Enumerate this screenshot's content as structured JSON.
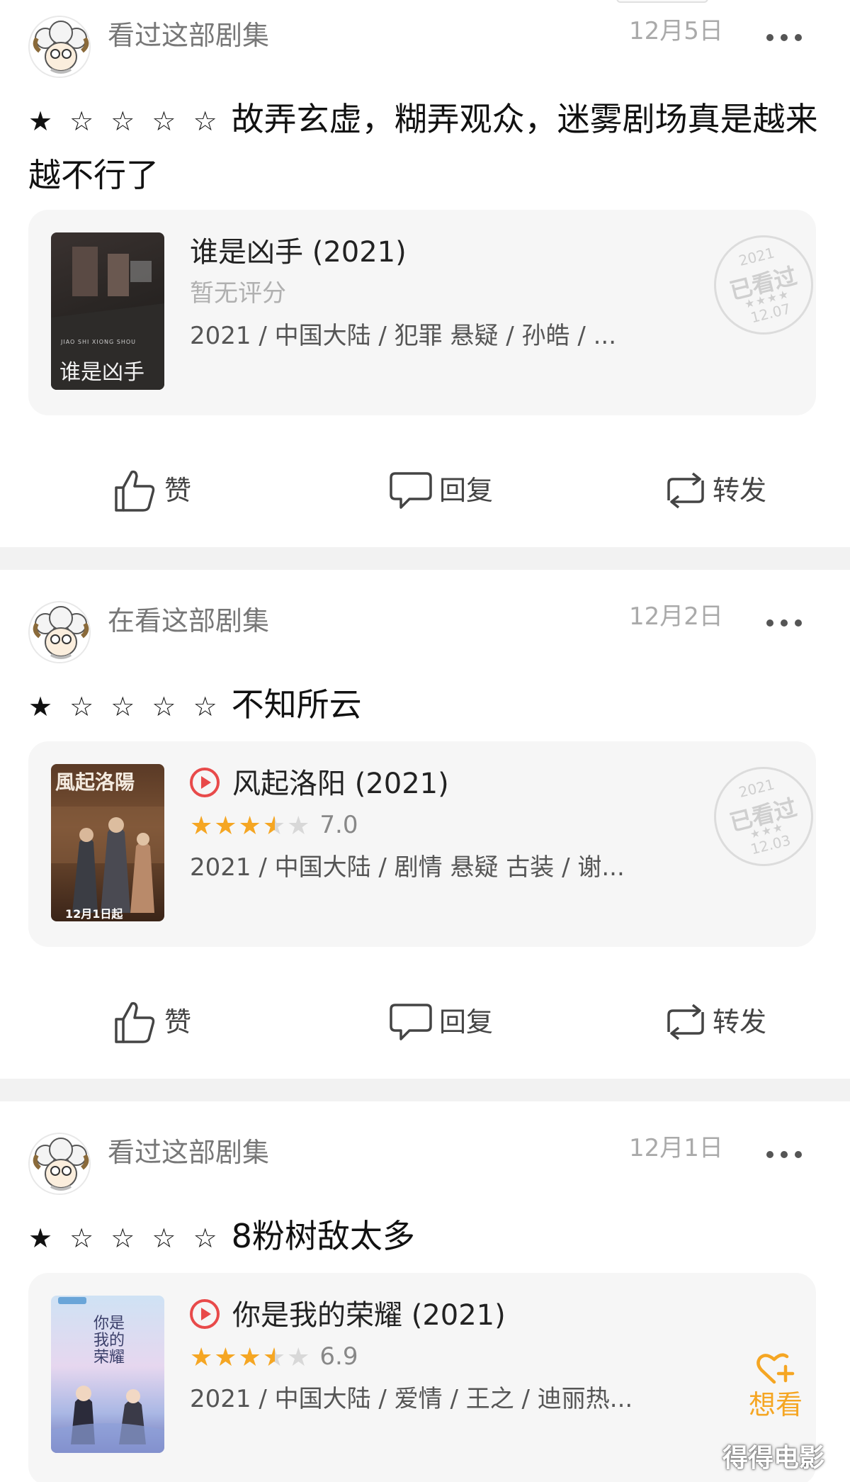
{
  "posts": [
    {
      "status": "看过这部剧集",
      "date": "12月5日",
      "stars": "★ ☆ ☆ ☆ ☆",
      "comment": "故弄玄虚，糊弄观众，迷雾剧场真是越来越不行了",
      "subject": {
        "title": "谁是凶手 (2021)",
        "rating_text": "暂无评分",
        "meta": "2021 / 中国大陆 / 犯罪 悬疑 / 孙皓 / ...",
        "stamp_year": "2021",
        "stamp_text": "已看过",
        "stamp_stars": "★★★★",
        "stamp_date": "12.07",
        "poster_text": "谁是凶手",
        "poster_sub": "JIAO SHI XIONG SHOU"
      },
      "actions": {
        "like": "赞",
        "reply": "回复",
        "share": "转发"
      }
    },
    {
      "status": "在看这部剧集",
      "date": "12月2日",
      "stars": "★ ☆ ☆ ☆ ☆",
      "comment": "不知所云",
      "subject": {
        "title": "风起洛阳 (2021)",
        "rating_stars": "★★★",
        "rating_half": "★",
        "rating_empty": "★",
        "rating_value": "7.0",
        "meta": "2021 / 中国大陆 / 剧情 悬疑 古装 / 谢...",
        "stamp_year": "2021",
        "stamp_text": "已看过",
        "stamp_stars": "★★★",
        "stamp_date": "12.03",
        "poster_text": "風起洛陽",
        "poster_badge": "12月1日起"
      },
      "actions": {
        "like": "赞",
        "reply": "回复",
        "share": "转发"
      }
    },
    {
      "status": "看过这部剧集",
      "date": "12月1日",
      "stars": "★ ☆ ☆ ☆ ☆",
      "comment": "8粉树敌太多",
      "subject": {
        "title": "你是我的荣耀 (2021)",
        "rating_stars": "★★★",
        "rating_half": "★",
        "rating_empty": "★",
        "rating_value": "6.9",
        "meta": "2021 / 中国大陆 / 爱情 / 王之 / 迪丽热...",
        "want_label": "想看",
        "poster_text": "你是我的荣耀"
      }
    }
  ],
  "watermark": "得得电影"
}
